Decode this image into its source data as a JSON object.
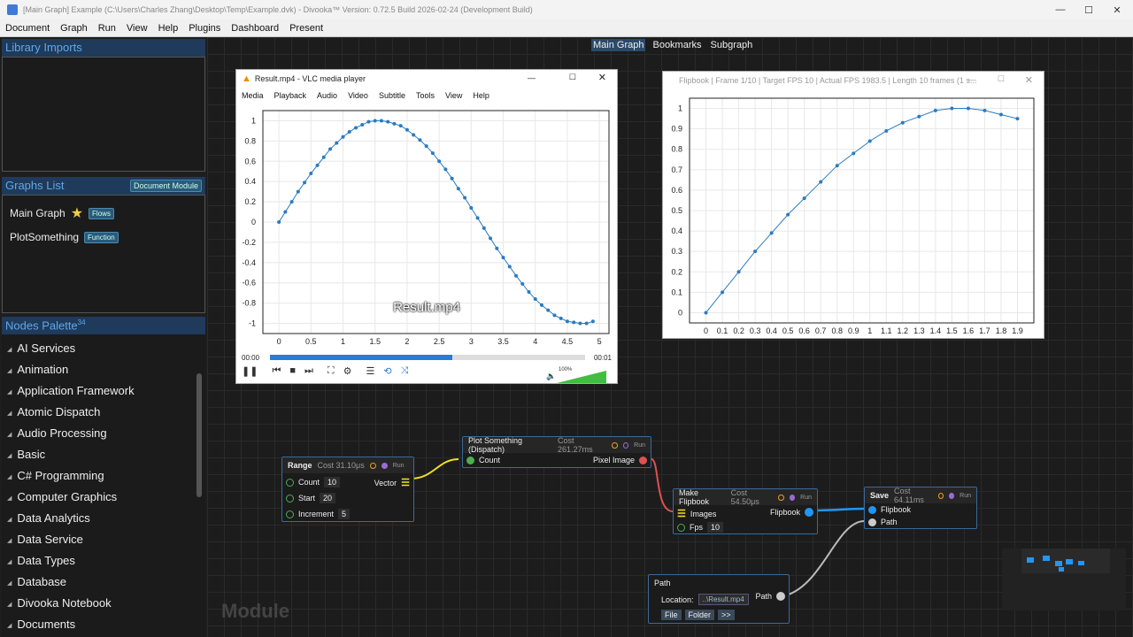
{
  "window": {
    "title": "[Main Graph] Example (C:\\Users\\Charles Zhang\\Desktop\\Temp\\Example.dvk) - Divooka™ Version: 0.72.5 Build 2026-02-24 (Development Build)",
    "minimize": "—",
    "maximize": "☐",
    "close": "✕"
  },
  "menu": [
    "Document",
    "Graph",
    "Run",
    "View",
    "Help",
    "Plugins",
    "Dashboard",
    "Present"
  ],
  "library": {
    "title": "Library Imports"
  },
  "graphs": {
    "title": "Graphs List",
    "module_btn": "Document Module",
    "items": [
      {
        "name": "Main Graph",
        "tag": "Flows",
        "star": "★"
      },
      {
        "name": "PlotSomething",
        "tag": "Function"
      }
    ]
  },
  "palette": {
    "title": "Nodes Palette",
    "count": "34",
    "items": [
      "AI Services",
      "Animation",
      "Application Framework",
      "Atomic Dispatch",
      "Audio Processing",
      "Basic",
      "C# Programming",
      "Computer Graphics",
      "Data Analytics",
      "Data Service",
      "Data Types",
      "Database",
      "Divooka Notebook",
      "Documents"
    ]
  },
  "tabs": [
    "Main Graph",
    "Bookmarks",
    "Subgraph"
  ],
  "watermark": "Module",
  "vlc": {
    "title": "Result.mp4 - VLC media player",
    "menu": [
      "Media",
      "Playback",
      "Audio",
      "Video",
      "Subtitle",
      "Tools",
      "View",
      "Help"
    ],
    "overlay": "Result.mp4",
    "time_start": "00:00",
    "time_end": "00:01",
    "volume": "100%",
    "progress": 0.58,
    "volume_level": 1.0
  },
  "flipbook": {
    "title": "Flipbook | Frame 1/10 | Target FPS 10 | Actual FPS 1983.5 | Length 10 frames (1 s..."
  },
  "chart_data": [
    {
      "type": "line",
      "x": [
        0,
        0.1,
        0.2,
        0.3,
        0.4,
        0.5,
        0.6,
        0.7,
        0.8,
        0.9,
        1.0,
        1.1,
        1.2,
        1.3,
        1.4,
        1.5,
        1.6,
        1.7,
        1.8,
        1.9,
        2.0,
        2.1,
        2.2,
        2.3,
        2.4,
        2.5,
        2.6,
        2.7,
        2.8,
        2.9,
        3.0,
        3.1,
        3.2,
        3.3,
        3.4,
        3.5,
        3.6,
        3.7,
        3.8,
        3.9,
        4.0,
        4.1,
        4.2,
        4.3,
        4.4,
        4.5,
        4.6,
        4.7,
        4.8,
        4.9
      ],
      "series": [
        {
          "values": [
            0,
            0.1,
            0.2,
            0.3,
            0.39,
            0.48,
            0.56,
            0.64,
            0.72,
            0.78,
            0.84,
            0.89,
            0.93,
            0.96,
            0.99,
            1.0,
            1.0,
            0.99,
            0.97,
            0.95,
            0.91,
            0.86,
            0.81,
            0.75,
            0.68,
            0.6,
            0.52,
            0.43,
            0.33,
            0.24,
            0.14,
            0.04,
            -0.06,
            -0.16,
            -0.26,
            -0.35,
            -0.44,
            -0.53,
            -0.61,
            -0.69,
            -0.76,
            -0.82,
            -0.87,
            -0.92,
            -0.95,
            -0.98,
            -0.99,
            -1.0,
            -1.0,
            -0.98
          ]
        }
      ],
      "xlim": [
        -0.25,
        5.15
      ],
      "ylim": [
        -1.1,
        1.1
      ],
      "xticks": [
        "0",
        "0.5",
        "1",
        "1.5",
        "2",
        "2.5",
        "3",
        "3.5",
        "4",
        "4.5",
        "5"
      ],
      "yticks": [
        "1",
        "0.8",
        "0.6",
        "0.4",
        "0.2",
        "0",
        "-0.2",
        "-0.4",
        "-0.6",
        "-0.8",
        "-1"
      ],
      "grid": true
    },
    {
      "type": "line",
      "x": [
        0,
        0.1,
        0.2,
        0.3,
        0.4,
        0.5,
        0.6,
        0.7,
        0.8,
        0.9,
        1.0,
        1.1,
        1.2,
        1.3,
        1.4,
        1.5,
        1.6,
        1.7,
        1.8,
        1.9
      ],
      "series": [
        {
          "values": [
            0,
            0.1,
            0.2,
            0.3,
            0.39,
            0.48,
            0.56,
            0.64,
            0.72,
            0.78,
            0.84,
            0.89,
            0.93,
            0.96,
            0.99,
            1.0,
            1.0,
            0.99,
            0.97,
            0.95
          ]
        }
      ],
      "xlim": [
        -0.1,
        2.0
      ],
      "ylim": [
        -0.05,
        1.05
      ],
      "xticks": [
        "0",
        "0.1",
        "0.2",
        "0.3",
        "0.4",
        "0.5",
        "0.6",
        "0.7",
        "0.8",
        "0.9",
        "1",
        "1.1",
        "1.2",
        "1.3",
        "1.4",
        "1.5",
        "1.6",
        "1.7",
        "1.8",
        "1.9"
      ],
      "yticks": [
        "1",
        "0.9",
        "0.8",
        "0.7",
        "0.6",
        "0.5",
        "0.4",
        "0.3",
        "0.2",
        "0.1",
        "0"
      ],
      "grid": true
    }
  ],
  "nodes": {
    "range": {
      "title": "Range",
      "cost": "Cost 31.10μs",
      "run": "Run",
      "count_label": "Count",
      "count_value": "10",
      "start_label": "Start",
      "start_value": "20",
      "increment_label": "Increment",
      "increment_value": "5",
      "out_label": "Vector"
    },
    "plot": {
      "title": "Plot Something (Dispatch)",
      "cost": "Cost 261.27ms",
      "run": "Run",
      "in_label": "Count",
      "out_label": "Pixel Image"
    },
    "flipbook": {
      "title": "Make Flipbook",
      "cost": "Cost 54.50μs",
      "run": "Run",
      "images_label": "Images",
      "fps_label": "Fps",
      "fps_value": "10",
      "out_label": "Flipbook"
    },
    "save": {
      "title": "Save",
      "cost": "Cost 64.11ms",
      "run": "Run",
      "flipbook_label": "Flipbook",
      "path_label": "Path"
    },
    "path": {
      "title": "Path",
      "location_label": "Location:",
      "location_value": "..\\Result.mp4",
      "out_label": "Path",
      "file_btn": "File",
      "folder_btn": "Folder",
      "more_btn": ">>"
    }
  },
  "colors": {
    "accent": "#3a6a9a",
    "pin_green": "#4caf50",
    "pin_yellow": "#f0e020",
    "pin_red": "#e05050",
    "pin_blue": "#2196f3",
    "pin_grey": "#cccccc",
    "link_yellow": "#f0e020",
    "link_red": "#e05050",
    "link_blue": "#2196f3",
    "link_grey": "#bbbbbb",
    "line": "#2a7bbf"
  }
}
